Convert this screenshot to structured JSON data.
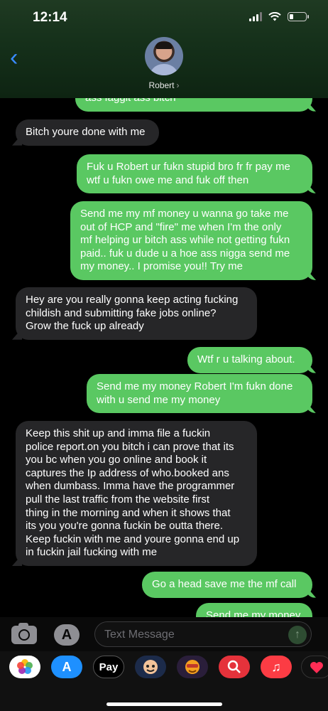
{
  "status": {
    "time": "12:14"
  },
  "header": {
    "contact_name": "Robert"
  },
  "messages": [
    {
      "dir": "out",
      "text": "ass faggit ass bitch"
    },
    {
      "dir": "in",
      "text": "Bitch youre done with me"
    },
    {
      "dir": "out",
      "text": "Fuk u Robert ur fukn stupid bro fr fr pay me\nwtf u fukn owe me and fuk off then"
    },
    {
      "dir": "out",
      "text": "Send me my mf money u wanna go take me\nout of HCP and \"fire\" me when I'm the only\nmf helping ur bitch ass while not getting fukn\npaid.. fuk u dude u a hoe ass nigga send me\nmy money.. I promise you!! Try me"
    },
    {
      "dir": "in",
      "text": "Hey are you really gonna keep acting fucking\nchildish and submitting fake jobs online?\nGrow the fuck up already"
    },
    {
      "dir": "out",
      "text": "Wtf r u talking about."
    },
    {
      "dir": "out",
      "text": "Send me my money Robert I'm fukn done\nwith u send me my money"
    },
    {
      "dir": "in",
      "text": "Keep this shit up and imma file a fuckin\npolice report.on you bitch i can prove that its\nyou bc when you go online and book it\ncaptures the Ip address of who.booked ans\nwhen dumbass. Imma have the programmer\npull the last traffic from the website first\nthing in the morning and when it shows that\nits you you're gonna fuckin be outta there.\nKeep fuckin with me and youre gonna end up\nin fuckin jail fucking with me"
    },
    {
      "dir": "out",
      "text": "Go a head save me the mf call"
    },
    {
      "dir": "out",
      "text": "Send me my money"
    }
  ],
  "composer": {
    "placeholder": "Text Message"
  },
  "drawer": {
    "apps": [
      {
        "name": "photos",
        "label": "",
        "color": "#ffffff"
      },
      {
        "name": "app-store",
        "label": "A",
        "color": "#1e90ff"
      },
      {
        "name": "apple-pay",
        "label": "Pay",
        "color": "#000000"
      },
      {
        "name": "memoji",
        "label": "",
        "color": "#1c2b4a"
      },
      {
        "name": "animoji",
        "label": "",
        "color": "#2a1e3a"
      },
      {
        "name": "web-search",
        "label": "",
        "color": "#e5323b"
      },
      {
        "name": "music",
        "label": "♫",
        "color": "#fc3c44"
      },
      {
        "name": "digital-touch",
        "label": "",
        "color": "#111111"
      }
    ]
  },
  "colors": {
    "outgoing": "#5ac862",
    "incoming": "#262628",
    "accent": "#3a8bff"
  }
}
